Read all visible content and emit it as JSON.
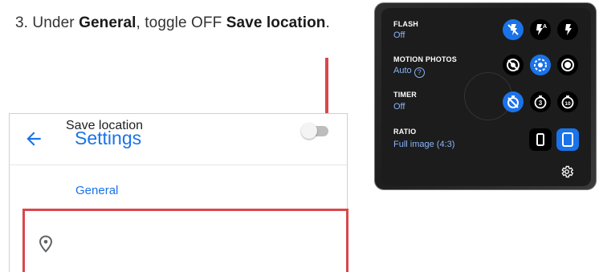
{
  "instruction": {
    "step": "3. Under ",
    "section": "General",
    "middle": ", toggle OFF ",
    "target": "Save location",
    "end": "."
  },
  "settings": {
    "title": "Settings",
    "section": "General",
    "rows": [
      {
        "label": "Save location",
        "icon": "location-pin-icon",
        "toggle_on": false
      }
    ]
  },
  "camera_menu": {
    "flash": {
      "label": "FLASH",
      "value": "Off",
      "options": [
        "flash-off-icon",
        "flash-auto-icon",
        "flash-on-icon"
      ],
      "selected": 0
    },
    "motion": {
      "label": "MOTION PHOTOS",
      "value": "Auto",
      "help": "?",
      "options": [
        "motion-off-icon",
        "motion-auto-icon",
        "motion-on-icon"
      ],
      "selected": 1
    },
    "timer": {
      "label": "TIMER",
      "value": "Off",
      "options": [
        "timer-off-icon",
        "timer-3s-icon",
        "timer-10s-icon"
      ],
      "option_labels": [
        "",
        "3",
        "10"
      ],
      "selected": 0
    },
    "ratio": {
      "label": "RATIO",
      "value": "Full image (4:3)",
      "options": [
        "ratio-narrow-icon",
        "ratio-full-icon"
      ],
      "selected": 1
    },
    "settings_icon": "gear-icon"
  },
  "colors": {
    "accent": "#1a73e8",
    "highlight": "#d9474b",
    "value_blue": "#8ab4f8"
  }
}
